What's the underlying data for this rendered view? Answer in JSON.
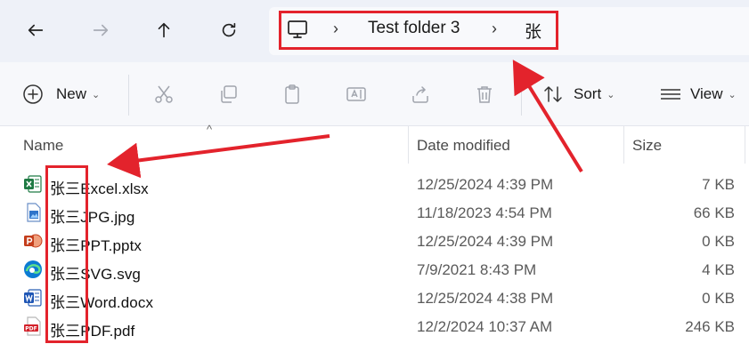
{
  "nav": {
    "back_icon": "arrow-left-icon",
    "forward_icon": "arrow-right-icon",
    "up_icon": "arrow-up-icon",
    "refresh_icon": "refresh-icon"
  },
  "breadcrumb": {
    "computer_icon": "monitor-icon",
    "sep1": "›",
    "folder": "Test folder 3",
    "sep2": "›",
    "current": "张"
  },
  "toolbar": {
    "new_label": "New",
    "sort_label": "Sort",
    "view_label": "View",
    "caret": "⌄"
  },
  "columns": {
    "name": "Name",
    "date": "Date modified",
    "size": "Size",
    "sort_indicator": "^"
  },
  "files": [
    {
      "name": "张三Excel.xlsx",
      "date": "12/25/2024 4:39 PM",
      "size": "7 KB",
      "icon": "excel-icon"
    },
    {
      "name": "张三JPG.jpg",
      "date": "11/18/2023 4:54 PM",
      "size": "66 KB",
      "icon": "image-icon"
    },
    {
      "name": "张三PPT.pptx",
      "date": "12/25/2024 4:39 PM",
      "size": "0 KB",
      "icon": "powerpoint-icon"
    },
    {
      "name": "张三SVG.svg",
      "date": "7/9/2021 8:43 PM",
      "size": "4 KB",
      "icon": "edge-icon"
    },
    {
      "name": "张三Word.docx",
      "date": "12/25/2024 4:38 PM",
      "size": "0 KB",
      "icon": "word-icon"
    },
    {
      "name": "张三PDF.pdf",
      "date": "12/2/2024 10:37 AM",
      "size": "246 KB",
      "icon": "pdf-icon"
    }
  ],
  "colors": {
    "annotation_red": "#e3232c",
    "navbar_bg": "#eef1f8",
    "toolbar_bg": "#f7f8fb"
  }
}
